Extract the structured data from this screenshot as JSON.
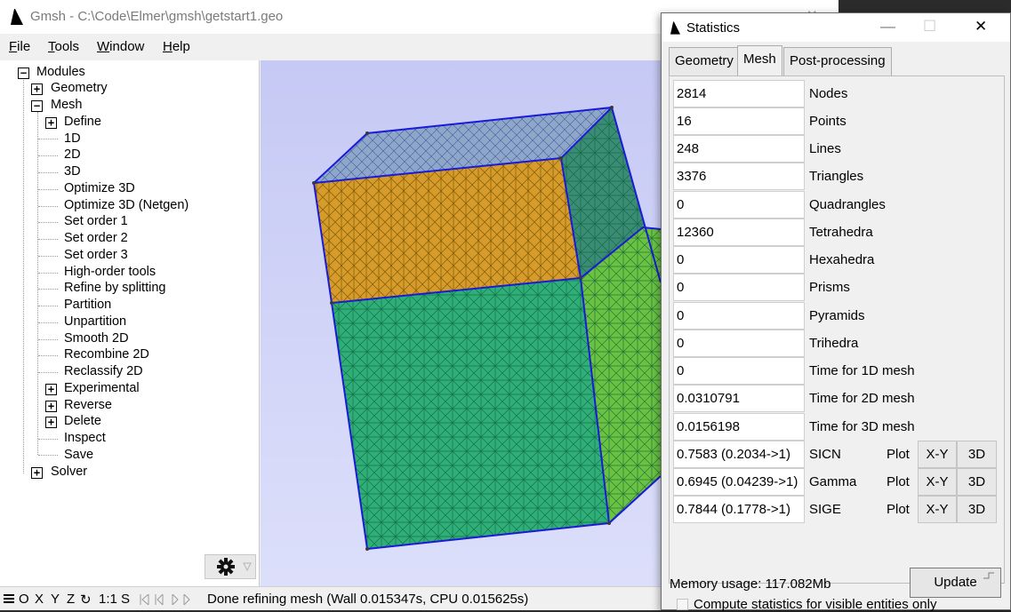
{
  "gmsh": {
    "title": "Gmsh - C:\\Code\\Elmer\\gmsh\\getstart1.geo",
    "window_controls": {
      "minimize": "—",
      "maximize": "☐",
      "close": "✕"
    },
    "menu": [
      {
        "label": "File",
        "accel": "F",
        "rest": "ile"
      },
      {
        "label": "Tools",
        "accel": "T",
        "rest": "ools"
      },
      {
        "label": "Window",
        "accel": "W",
        "rest": "indow"
      },
      {
        "label": "Help",
        "accel": "H",
        "rest": "elp"
      }
    ],
    "tree": {
      "modules": "Modules",
      "geometry": "Geometry",
      "mesh": "Mesh",
      "define": "Define",
      "items": [
        "1D",
        "2D",
        "3D",
        "Optimize 3D",
        "Optimize 3D (Netgen)",
        "Set order 1",
        "Set order 2",
        "Set order 3",
        "High-order tools",
        "Refine by splitting",
        "Partition",
        "Unpartition",
        "Smooth 2D",
        "Recombine 2D",
        "Reclassify 2D"
      ],
      "experimental": "Experimental",
      "reverse": "Reverse",
      "delete": "Delete",
      "inspect": "Inspect",
      "save": "Save",
      "solver": "Solver"
    },
    "status": {
      "buttons": [
        "O",
        "X",
        "Y",
        "Z",
        "↻",
        "1:1",
        "S"
      ],
      "message": "Done refining mesh (Wall 0.015347s, CPU 0.015625s)"
    }
  },
  "stats": {
    "title": "Statistics",
    "tabs": [
      "Geometry",
      "Mesh",
      "Post-processing"
    ],
    "active_tab": "Mesh",
    "rows": [
      {
        "value": "2814",
        "label": "Nodes"
      },
      {
        "value": "16",
        "label": "Points"
      },
      {
        "value": "248",
        "label": "Lines"
      },
      {
        "value": "3376",
        "label": "Triangles"
      },
      {
        "value": "0",
        "label": "Quadrangles"
      },
      {
        "value": "12360",
        "label": "Tetrahedra"
      },
      {
        "value": "0",
        "label": "Hexahedra"
      },
      {
        "value": "0",
        "label": "Prisms"
      },
      {
        "value": "0",
        "label": "Pyramids"
      },
      {
        "value": "0",
        "label": "Trihedra"
      },
      {
        "value": "0",
        "label": "Time for 1D mesh"
      },
      {
        "value": "0.0310791",
        "label": "Time for 2D mesh"
      },
      {
        "value": "0.0156198",
        "label": "Time for 3D mesh"
      }
    ],
    "quality_rows": [
      {
        "value": "0.7583 (0.2034->1)",
        "label": "SICN"
      },
      {
        "value": "0.6945 (0.04239->1)",
        "label": "Gamma"
      },
      {
        "value": "0.7844 (0.1778->1)",
        "label": "SIGE"
      }
    ],
    "plot_label": "Plot",
    "xy_button": "X-Y",
    "threed_button": "3D",
    "checkbox_label": "Compute statistics for visible entities only",
    "memory": "Memory usage: 117.082Mb",
    "update": "Update"
  }
}
